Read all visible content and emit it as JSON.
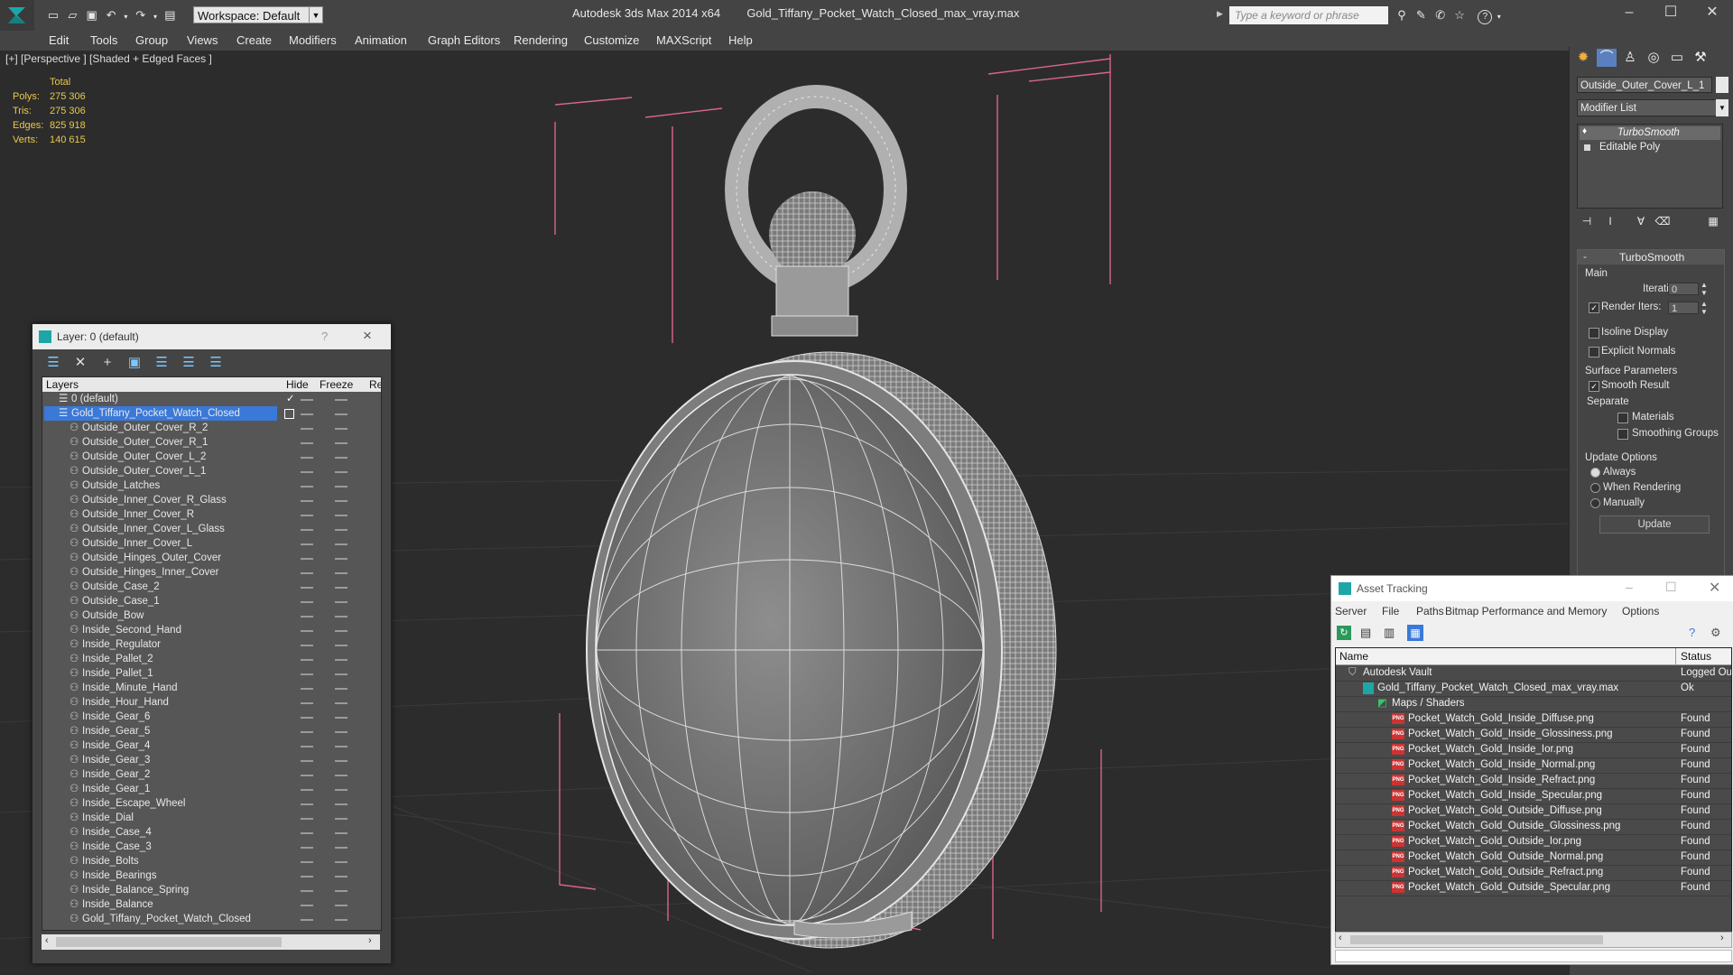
{
  "titlebar": {
    "workspace": "Workspace: Default",
    "app_title": "Autodesk 3ds Max  2014 x64",
    "file_title": "Gold_Tiffany_Pocket_Watch_Closed_max_vray.max",
    "search_placeholder": "Type a keyword or phrase"
  },
  "menubar": [
    "Edit",
    "Tools",
    "Group",
    "Views",
    "Create",
    "Modifiers",
    "Animation",
    "Graph Editors",
    "Rendering",
    "Customize",
    "MAXScript",
    "Help"
  ],
  "viewport": {
    "label": "[+] [Perspective ] [Shaded + Edged Faces ]",
    "stats_header": "Total",
    "stats": [
      {
        "label": "Polys:",
        "value": "275 306"
      },
      {
        "label": "Tris:",
        "value": "275 306"
      },
      {
        "label": "Edges:",
        "value": "825 918"
      },
      {
        "label": "Verts:",
        "value": "140 615"
      }
    ]
  },
  "layer_window": {
    "title": "Layer: 0 (default)",
    "help": "?",
    "close": "×",
    "columns": {
      "layers": "Layers",
      "hide": "Hide",
      "freeze": "Freeze",
      "render": "Re"
    },
    "default_layer": "0 (default)",
    "selected_layer": "Gold_Tiffany_Pocket_Watch_Closed",
    "objects": [
      "Outside_Outer_Cover_R_2",
      "Outside_Outer_Cover_R_1",
      "Outside_Outer_Cover_L_2",
      "Outside_Outer_Cover_L_1",
      "Outside_Latches",
      "Outside_Inner_Cover_R_Glass",
      "Outside_Inner_Cover_R",
      "Outside_Inner_Cover_L_Glass",
      "Outside_Inner_Cover_L",
      "Outside_Hinges_Outer_Cover",
      "Outside_Hinges_Inner_Cover",
      "Outside_Case_2",
      "Outside_Case_1",
      "Outside_Bow",
      "Inside_Second_Hand",
      "Inside_Regulator",
      "Inside_Pallet_2",
      "Inside_Pallet_1",
      "Inside_Minute_Hand",
      "Inside_Hour_Hand",
      "Inside_Gear_6",
      "Inside_Gear_5",
      "Inside_Gear_4",
      "Inside_Gear_3",
      "Inside_Gear_2",
      "Inside_Gear_1",
      "Inside_Escape_Wheel",
      "Inside_Dial",
      "Inside_Case_4",
      "Inside_Case_3",
      "Inside_Bolts",
      "Inside_Bearings",
      "Inside_Balance_Spring",
      "Inside_Balance",
      "Gold_Tiffany_Pocket_Watch_Closed"
    ]
  },
  "command_panel": {
    "object_name": "Outside_Outer_Cover_L_1",
    "modifier_list": "Modifier List",
    "stack": [
      "TurboSmooth",
      "Editable Poly"
    ],
    "rollout_title": "TurboSmooth",
    "main_group": "Main",
    "iterations_label": "Iterations:",
    "iterations_value": "0",
    "render_iters_label": "Render Iters:",
    "render_iters_value": "1",
    "isoline_label": "Isoline Display",
    "explicit_normals_label": "Explicit Normals",
    "surface_group": "Surface Parameters",
    "smooth_result_label": "Smooth Result",
    "separate_label": "Separate",
    "materials_label": "Materials",
    "smoothing_groups_label": "Smoothing Groups",
    "update_group": "Update Options",
    "always_label": "Always",
    "when_rendering_label": "When Rendering",
    "manually_label": "Manually",
    "update_button": "Update"
  },
  "asset_tracking": {
    "title": "Asset Tracking",
    "menu": [
      "Server",
      "File",
      "Paths",
      "Bitmap Performance and Memory",
      "Options"
    ],
    "col_name": "Name",
    "col_status": "Status",
    "vault": {
      "name": "Autodesk Vault",
      "status": "Logged Ou"
    },
    "file": {
      "name": "Gold_Tiffany_Pocket_Watch_Closed_max_vray.max",
      "status": "Ok"
    },
    "maps_group": "Maps / Shaders",
    "maps": [
      {
        "name": "Pocket_Watch_Gold_Inside_Diffuse.png",
        "status": "Found"
      },
      {
        "name": "Pocket_Watch_Gold_Inside_Glossiness.png",
        "status": "Found"
      },
      {
        "name": "Pocket_Watch_Gold_Inside_Ior.png",
        "status": "Found"
      },
      {
        "name": "Pocket_Watch_Gold_Inside_Normal.png",
        "status": "Found"
      },
      {
        "name": "Pocket_Watch_Gold_Inside_Refract.png",
        "status": "Found"
      },
      {
        "name": "Pocket_Watch_Gold_Inside_Specular.png",
        "status": "Found"
      },
      {
        "name": "Pocket_Watch_Gold_Outside_Diffuse.png",
        "status": "Found"
      },
      {
        "name": "Pocket_Watch_Gold_Outside_Glossiness.png",
        "status": "Found"
      },
      {
        "name": "Pocket_Watch_Gold_Outside_Ior.png",
        "status": "Found"
      },
      {
        "name": "Pocket_Watch_Gold_Outside_Normal.png",
        "status": "Found"
      },
      {
        "name": "Pocket_Watch_Gold_Outside_Refract.png",
        "status": "Found"
      },
      {
        "name": "Pocket_Watch_Gold_Outside_Specular.png",
        "status": "Found"
      }
    ]
  },
  "colors": {
    "selection": "#3a79d8",
    "stats": "#e9c94b",
    "bbox": "#e05a7a"
  }
}
